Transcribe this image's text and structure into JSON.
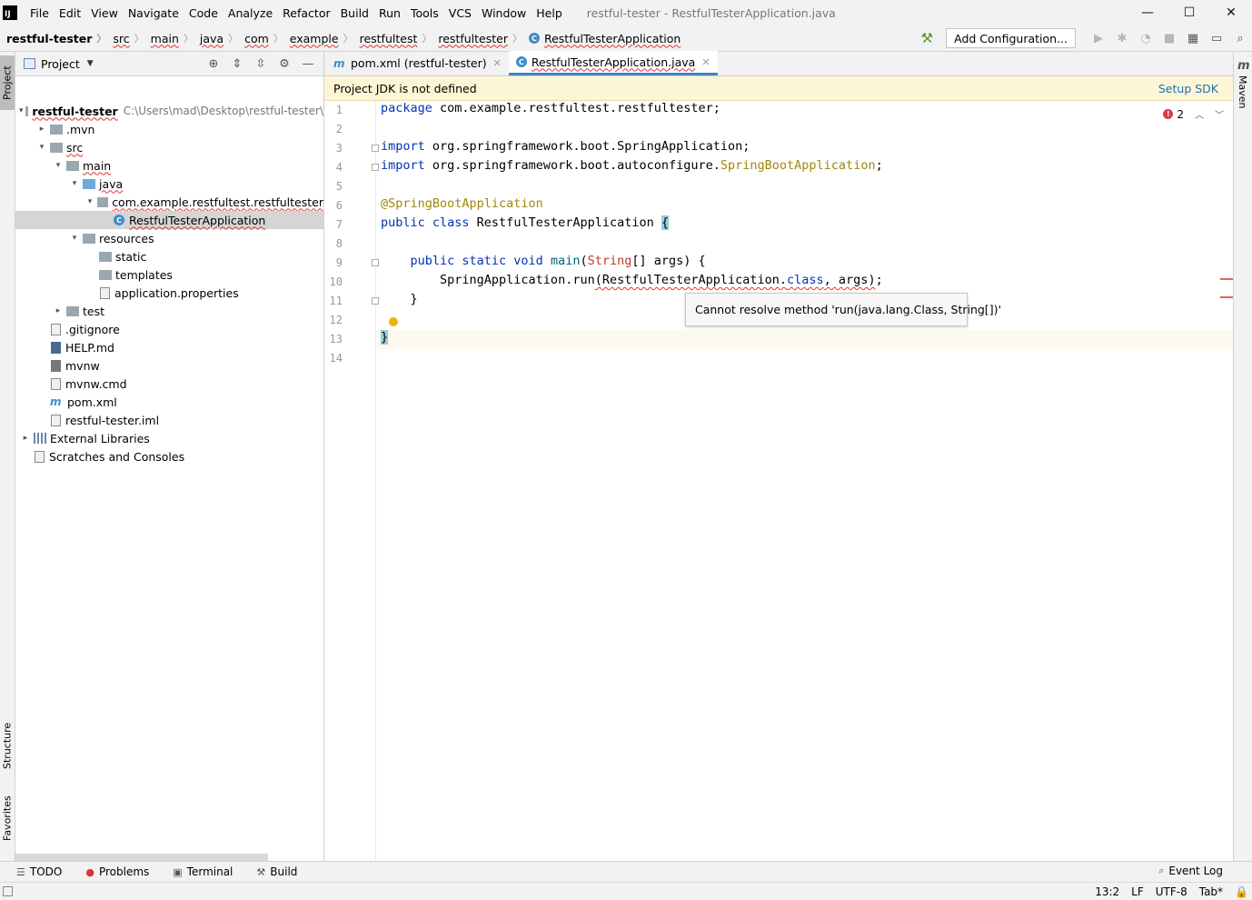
{
  "menu": {
    "logo": "IJ",
    "items": [
      "File",
      "Edit",
      "View",
      "Navigate",
      "Code",
      "Analyze",
      "Refactor",
      "Build",
      "Run",
      "Tools",
      "VCS",
      "Window",
      "Help"
    ],
    "window_title": "restful-tester - RestfulTesterApplication.java"
  },
  "window_controls": {
    "minimize": "—",
    "maximize": "☐",
    "close": "✕"
  },
  "breadcrumbs": [
    "restful-tester",
    "src",
    "main",
    "java",
    "com",
    "example",
    "restfultest",
    "restfultester",
    "RestfulTesterApplication"
  ],
  "toolbar": {
    "add_configuration": "Add Configuration...",
    "build_icon": "hammer-icon",
    "run_icon": "run-icon",
    "debug_icon": "debug-icon"
  },
  "left_stripe": {
    "project": "Project",
    "structure": "Structure",
    "favorites": "Favorites"
  },
  "right_stripe": {
    "maven": "Maven"
  },
  "project_panel": {
    "title": "Project",
    "tree": [
      {
        "label": "restful-tester",
        "hint": "C:\\Users\\mad\\Desktop\\restful-tester\\",
        "kind": "module",
        "arrow": "▾",
        "depth": 0
      },
      {
        "label": ".mvn",
        "kind": "folder",
        "arrow": "▸",
        "depth": 1
      },
      {
        "label": "src",
        "kind": "folder",
        "arrow": "▾",
        "depth": 1
      },
      {
        "label": "main",
        "kind": "folder",
        "arrow": "▾",
        "depth": 2
      },
      {
        "label": "java",
        "kind": "folder-blue",
        "arrow": "▾",
        "depth": 3
      },
      {
        "label": "com.example.restfultest.restfultester",
        "kind": "package",
        "arrow": "▾",
        "depth": 4
      },
      {
        "label": "RestfulTesterApplication",
        "kind": "class",
        "arrow": "",
        "depth": 5,
        "selected": true
      },
      {
        "label": "resources",
        "kind": "folder-res",
        "arrow": "▾",
        "depth": 3
      },
      {
        "label": "static",
        "kind": "folder",
        "arrow": "",
        "depth": 4
      },
      {
        "label": "templates",
        "kind": "folder",
        "arrow": "",
        "depth": 4
      },
      {
        "label": "application.properties",
        "kind": "props",
        "arrow": "",
        "depth": 4
      },
      {
        "label": "test",
        "kind": "folder",
        "arrow": "▸",
        "depth": 2
      },
      {
        "label": ".gitignore",
        "kind": "file",
        "arrow": "",
        "depth": 1
      },
      {
        "label": "HELP.md",
        "kind": "md",
        "arrow": "",
        "depth": 1
      },
      {
        "label": "mvnw",
        "kind": "term",
        "arrow": "",
        "depth": 1
      },
      {
        "label": "mvnw.cmd",
        "kind": "file",
        "arrow": "",
        "depth": 1
      },
      {
        "label": "pom.xml",
        "kind": "pom",
        "arrow": "",
        "depth": 1
      },
      {
        "label": "restful-tester.iml",
        "kind": "file",
        "arrow": "",
        "depth": 1
      },
      {
        "label": "External Libraries",
        "kind": "lib",
        "arrow": "▸",
        "depth": 0
      },
      {
        "label": "Scratches and Consoles",
        "kind": "scratch",
        "arrow": "",
        "depth": 0
      }
    ]
  },
  "editor": {
    "tabs": [
      {
        "label": "pom.xml (restful-tester)",
        "active": false,
        "icon": "maven-icon"
      },
      {
        "label": "RestfulTesterApplication.java",
        "active": true,
        "icon": "class-icon"
      }
    ],
    "banner": {
      "message": "Project JDK is not defined",
      "action": "Setup SDK"
    },
    "line_numbers": [
      "1",
      "2",
      "3",
      "4",
      "5",
      "6",
      "7",
      "8",
      "9",
      "10",
      "11",
      "12",
      "13",
      "14"
    ],
    "inspection_count": "2",
    "tooltip": "Cannot resolve method 'run(java.lang.Class, String[])'",
    "current_line": 13
  },
  "bottom_tools": {
    "todo": "TODO",
    "problems": "Problems",
    "terminal": "Terminal",
    "build": "Build",
    "event_log": "Event Log"
  },
  "status": {
    "position": "13:2",
    "line_sep": "LF",
    "encoding": "UTF-8",
    "indent": "Tab*"
  }
}
